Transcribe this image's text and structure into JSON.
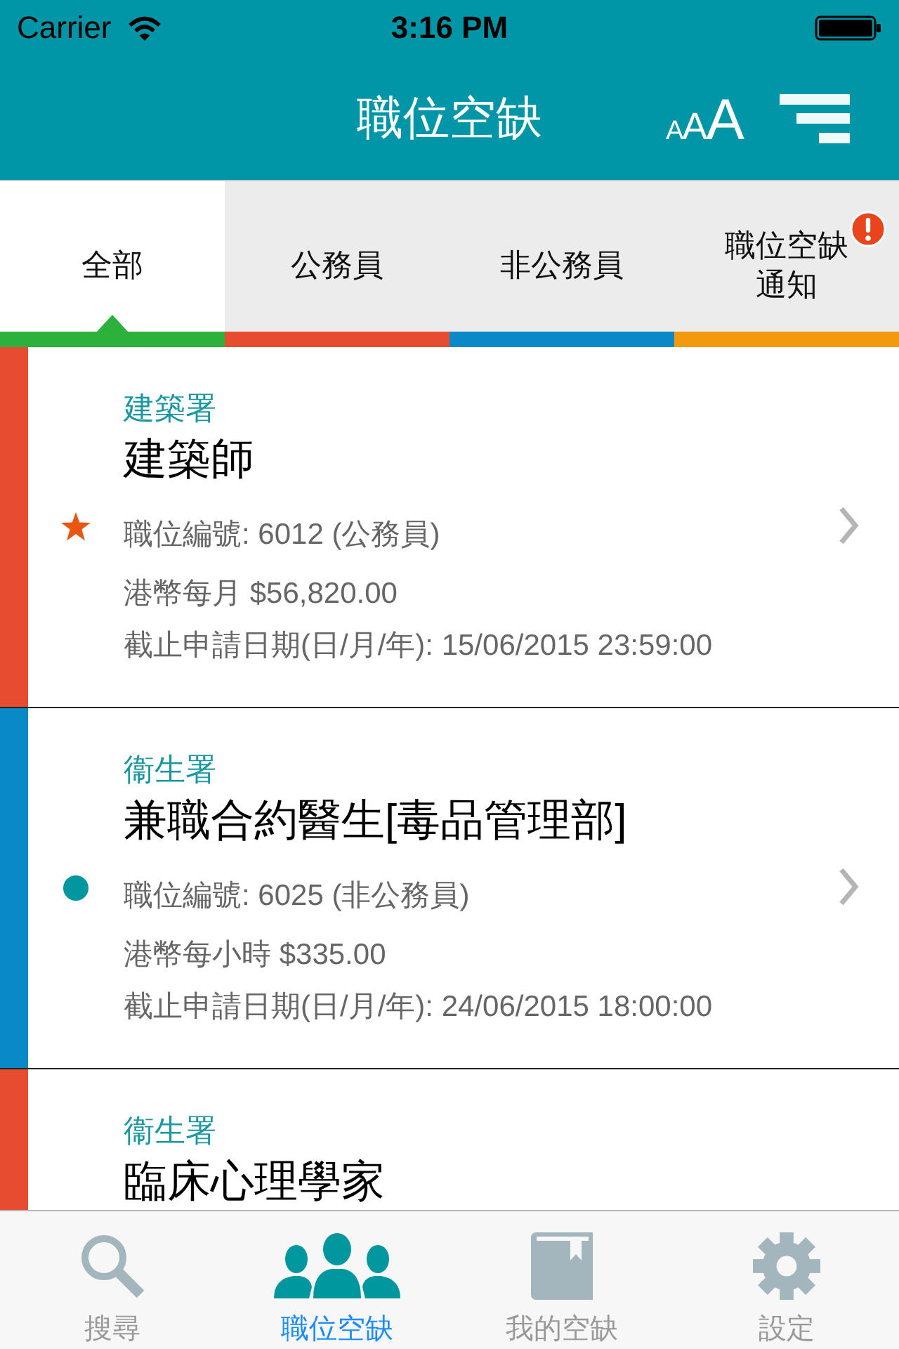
{
  "status_bar": {
    "carrier": "Carrier",
    "time": "3:16 PM"
  },
  "nav_bar": {
    "title": "職位空缺",
    "text_size_button": "AAA"
  },
  "tabs": [
    {
      "label": "全部",
      "selected": true,
      "color": "#2db13d",
      "alert": false
    },
    {
      "label": "公務員",
      "selected": false,
      "color": "#e84c2e",
      "alert": false
    },
    {
      "label": "非公務員",
      "selected": false,
      "color": "#0a89c9",
      "alert": false
    },
    {
      "label": "職位空缺通知",
      "selected": false,
      "color": "#f39a0c",
      "alert": true
    }
  ],
  "cards": [
    {
      "color": "#e84c2e",
      "agency": "建築署",
      "title": "建築師",
      "marker": {
        "kind": "star"
      },
      "post_no": "職位編號: 6012 (公務員)",
      "salary": "港幣每月 $56,820.00",
      "deadline": "截止申請日期(日/月/年): 15/06/2015 23:59:00"
    },
    {
      "color": "#0a89c9",
      "agency": "衞生署",
      "title": "兼職合約醫生[毒品管理部]",
      "marker": {
        "kind": "dot"
      },
      "post_no": "職位編號: 6025 (非公務員)",
      "salary": "港幣每小時 $335.00",
      "deadline": "截止申請日期(日/月/年): 24/06/2015 18:00:00"
    },
    {
      "color": "#e84c2e",
      "agency": "衞生署",
      "title": "臨床心理學家"
    }
  ],
  "tab_bar": [
    {
      "label": "搜尋",
      "selected": false
    },
    {
      "label": "職位空缺",
      "selected": true
    },
    {
      "label": "我的空缺",
      "selected": false
    },
    {
      "label": "設定",
      "selected": false
    }
  ]
}
